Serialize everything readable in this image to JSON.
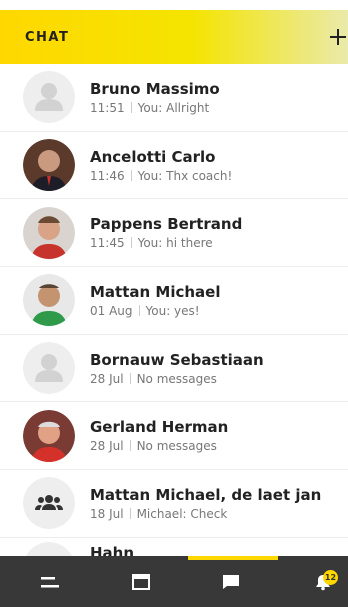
{
  "header": {
    "title": "CHAT"
  },
  "chats": [
    {
      "name": "Bruno Massimo",
      "date": "11:51",
      "preview": "You: Allright",
      "avatar": "default-avatar-icon"
    },
    {
      "name": "Ancelotti Carlo",
      "date": "11:46",
      "preview": "You: Thx coach!",
      "avatar": "photo"
    },
    {
      "name": "Pappens Bertrand",
      "date": "11:45",
      "preview": "You: hi there",
      "avatar": "photo"
    },
    {
      "name": "Mattan Michael",
      "date": "01 Aug",
      "preview": "You: yes!",
      "avatar": "photo"
    },
    {
      "name": "Bornauw Sebastiaan",
      "date": "28 Jul",
      "preview": "No messages",
      "avatar": "default-avatar-icon"
    },
    {
      "name": "Gerland Herman",
      "date": "28 Jul",
      "preview": "No messages",
      "avatar": "photo"
    },
    {
      "name": "Mattan Michael, de laet jan",
      "date": "18 Jul",
      "preview": "Michael: Check",
      "avatar": "group-icon"
    },
    {
      "name": "Hahn",
      "date": "",
      "preview": "",
      "avatar": "default-avatar-icon"
    }
  ],
  "bottom_nav": {
    "items": [
      "menu-icon",
      "window-icon",
      "chat-icon",
      "notification-bell-icon"
    ],
    "active": "chat-icon",
    "badge": "12"
  },
  "colors": {
    "accent": "#ffd800",
    "nav_bg": "#383838"
  }
}
